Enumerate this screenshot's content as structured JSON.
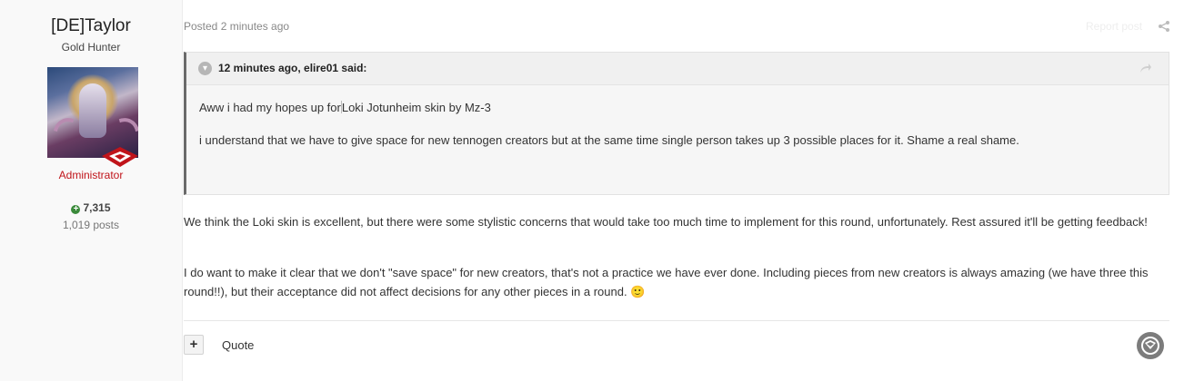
{
  "author": {
    "name": "[DE]Taylor",
    "title": "Gold Hunter",
    "role": "Administrator",
    "reputation": "7,315",
    "posts": "1,019 posts"
  },
  "post": {
    "posted": "Posted 2 minutes ago",
    "report_label": "Report post"
  },
  "quote": {
    "author": "12 minutes ago, elire01 said:",
    "line1_a": "Aww i had my hopes up for",
    "line1_b": "Loki Jotunheim skin by Mz-3",
    "line2": "i understand that we have to give space for new tennogen creators but at the same time single person takes up 3 possible places for it. Shame a real shame."
  },
  "body": {
    "para1": "We think the Loki skin is excellent, but there were some stylistic concerns that would take too much time to implement for this round, unfortunately. Rest assured it'll be getting feedback!",
    "para2": "I do want to make it clear that we don't \"save space\" for new creators, that's not a practice we have ever done. Including pieces from new creators is always amazing (we have three this round!!), but their acceptance did not affect decisions for any other pieces in a round. 🙂"
  },
  "actions": {
    "plus": "+",
    "quote": "Quote"
  },
  "colors": {
    "role": "#c0141a",
    "rep_icon": "#3a8a3a",
    "quote_border": "#6a6a6a"
  }
}
